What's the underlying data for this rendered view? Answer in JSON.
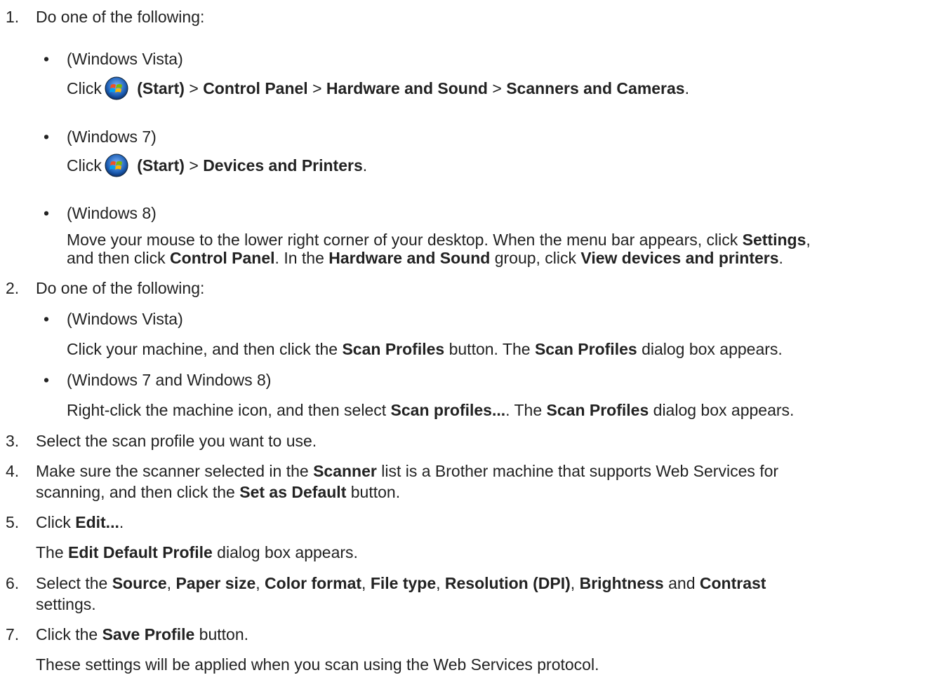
{
  "steps": [
    {
      "number": "1.",
      "text": "Do one of the following:",
      "options": [
        {
          "label": "(Windows Vista)",
          "detail": {
            "click": "Click",
            "start": "(Start)",
            "sep1": ">",
            "control_panel": "Control Panel",
            "sep2": ">",
            "hardware_sound": "Hardware and Sound",
            "sep3": ">",
            "scanners_cameras": "Scanners and Cameras",
            "end": "."
          }
        },
        {
          "label": "(Windows 7)",
          "detail": {
            "click": "Click",
            "start": "(Start)",
            "sep1": ">",
            "devices_printers": "Devices and Printers",
            "end": "."
          }
        },
        {
          "label": "(Windows 8)",
          "detail": {
            "t1": "Move your mouse to the lower right corner of your desktop. When the menu bar appears, click",
            "settings": "Settings",
            "t2": ",",
            "t3": "and then click",
            "control_panel": "Control Panel",
            "t4": ". In the",
            "hardware_sound": "Hardware and Sound",
            "t5": "group, click",
            "view_devices": "View devices and printers",
            "t6": "."
          }
        }
      ]
    },
    {
      "number": "2.",
      "text": "Do one of the following:",
      "options": [
        {
          "label": "(Windows Vista)",
          "detail": {
            "t1": "Click your machine, and then click the",
            "scan_profiles_btn": "Scan Profiles",
            "t2": "button. The",
            "scan_profiles_dlg": "Scan Profiles",
            "t3": "dialog box appears."
          }
        },
        {
          "label": "(Windows 7 and Windows 8)",
          "detail": {
            "t1": "Right-click the machine icon, and then select",
            "scan_profiles_menu": "Scan profiles...",
            "t2": ". The",
            "scan_profiles_dlg": "Scan Profiles",
            "t3": "dialog box appears."
          }
        }
      ]
    },
    {
      "number": "3.",
      "text": "Select the scan profile you want to use."
    },
    {
      "number": "4.",
      "t1": "Make sure the scanner selected in the",
      "scanner": "Scanner",
      "t2": "list is a Brother machine that supports Web Services for",
      "t3": "scanning, and then click the",
      "set_default": "Set as Default",
      "t4": "button."
    },
    {
      "number": "5.",
      "t1": "Click",
      "edit": "Edit...",
      "t2": ".",
      "t3": "The",
      "edit_default": "Edit Default Profile",
      "t4": "dialog box appears."
    },
    {
      "number": "6.",
      "t1": "Select the",
      "source": "Source",
      "c1": ",",
      "paper_size": "Paper size",
      "c2": ",",
      "color_format": "Color format",
      "c3": ",",
      "file_type": "File type",
      "c4": ",",
      "resolution": "Resolution (DPI)",
      "c5": ",",
      "brightness": "Brightness",
      "and": "and",
      "contrast": "Contrast",
      "t2": "settings."
    },
    {
      "number": "7.",
      "t1": "Click the",
      "save_profile": "Save Profile",
      "t2": "button.",
      "t3": "These settings will be applied when you scan using the Web Services protocol."
    }
  ],
  "bullet_char": "•",
  "icons": {
    "start_button": "windows-start-orb-icon"
  }
}
